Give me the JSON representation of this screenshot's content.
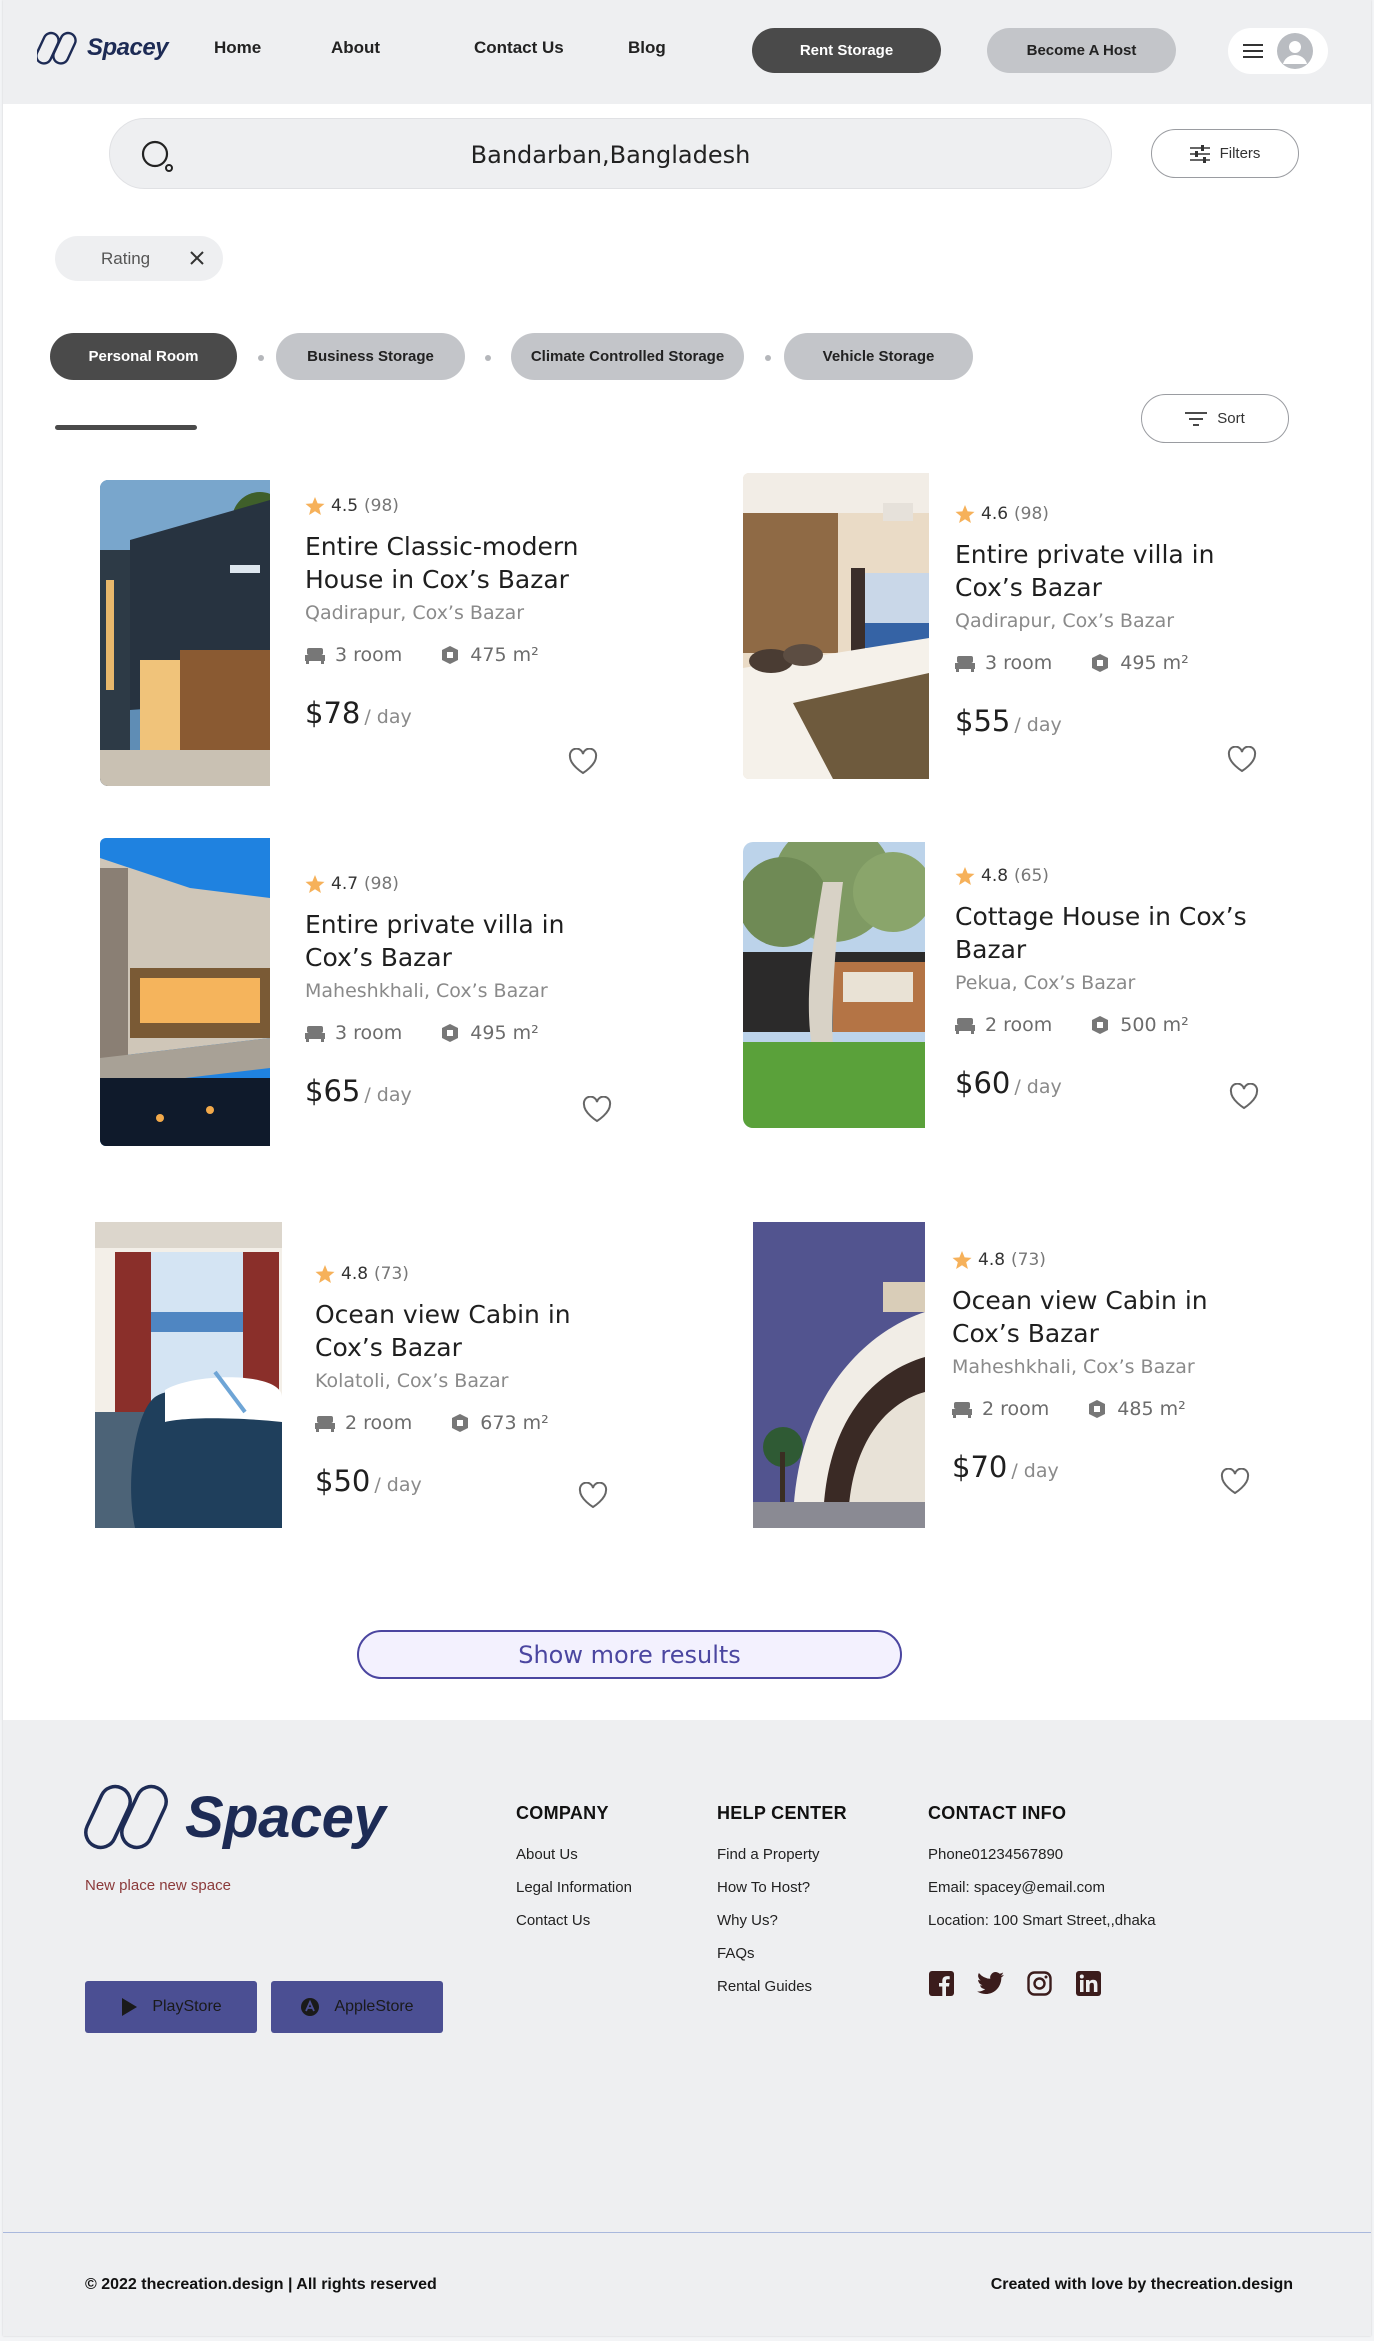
{
  "header": {
    "logo": "Spacey",
    "nav": [
      "Home",
      "About",
      "Contact Us",
      "Blog"
    ],
    "rent_label": "Rent Storage",
    "host_label": "Become A Host"
  },
  "search": {
    "value": "Bandarban,Bangladesh",
    "filters_label": "Filters"
  },
  "active_filter": {
    "label": "Rating"
  },
  "tabs": [
    "Personal Room",
    "Business Storage",
    "Climate Controlled Storage",
    "Vehicle Storage"
  ],
  "sort_label": "Sort",
  "listings": [
    {
      "rating": "4.5",
      "count": "(98)",
      "title": "Entire Classic-modern House in Cox’s Bazar",
      "location": "Qadirapur, Cox’s Bazar",
      "rooms": "3 room",
      "area": "475 m²",
      "price": "$78",
      "per": " / day"
    },
    {
      "rating": "4.6",
      "count": "(98)",
      "title": "Entire private villa in Cox’s Bazar",
      "location": "Qadirapur, Cox’s Bazar",
      "rooms": "3 room",
      "area": "495 m²",
      "price": "$55",
      "per": " / day"
    },
    {
      "rating": "4.7",
      "count": "(98)",
      "title": "Entire private villa in Cox’s Bazar",
      "location": "Maheshkhali, Cox’s Bazar",
      "rooms": "3 room",
      "area": "495 m²",
      "price": "$65",
      "per": " / day"
    },
    {
      "rating": "4.8",
      "count": "(65)",
      "title": "Cottage House in Cox’s Bazar",
      "location": "Pekua, Cox’s Bazar",
      "rooms": "2 room",
      "area": "500 m²",
      "price": "$60",
      "per": "/ day"
    },
    {
      "rating": "4.8",
      "count": "(73)",
      "title": "Ocean view Cabin in Cox’s Bazar",
      "location": "Kolatoli, Cox’s Bazar",
      "rooms": "2 room",
      "area": "673 m²",
      "price": "$50",
      "per": "/ day"
    },
    {
      "rating": "4.8",
      "count": "(73)",
      "title": "Ocean view Cabin in Cox’s Bazar",
      "location": "Maheshkhali, Cox’s Bazar",
      "rooms": "2 room",
      "area": "485 m²",
      "price": "$70",
      "per": "/ day"
    }
  ],
  "show_more_label": "Show more results",
  "footer": {
    "logo": "Spacey",
    "tagline": "New place new  space",
    "playstore_label": "PlayStore",
    "applestore_label": "AppleStore",
    "company": {
      "heading": "COMPANY",
      "links": [
        "About Us",
        "Legal Information",
        "Contact Us"
      ]
    },
    "help": {
      "heading": "HELP CENTER",
      "links": [
        "Find a Property",
        "How To Host?",
        "Why Us?",
        "FAQs",
        "Rental Guides"
      ]
    },
    "contact": {
      "heading": "CONTACT INFO",
      "lines": [
        "Phone01234567890",
        "Email: spacey@email.com",
        "Location: 100 Smart Street,,dhaka"
      ]
    },
    "social_icons": [
      "facebook-icon",
      "twitter-icon",
      "instagram-icon",
      "linkedin-icon"
    ],
    "copyright": "© 2022 thecreation.design | All rights reserved",
    "credit_prefix": "Created with love by ",
    "credit_brand": "thecreation.design"
  },
  "colors": {
    "brand": "#1d2b55",
    "accent": "#4b46a0",
    "star": "#f6b15a",
    "dark_button": "#4a4a4a"
  }
}
